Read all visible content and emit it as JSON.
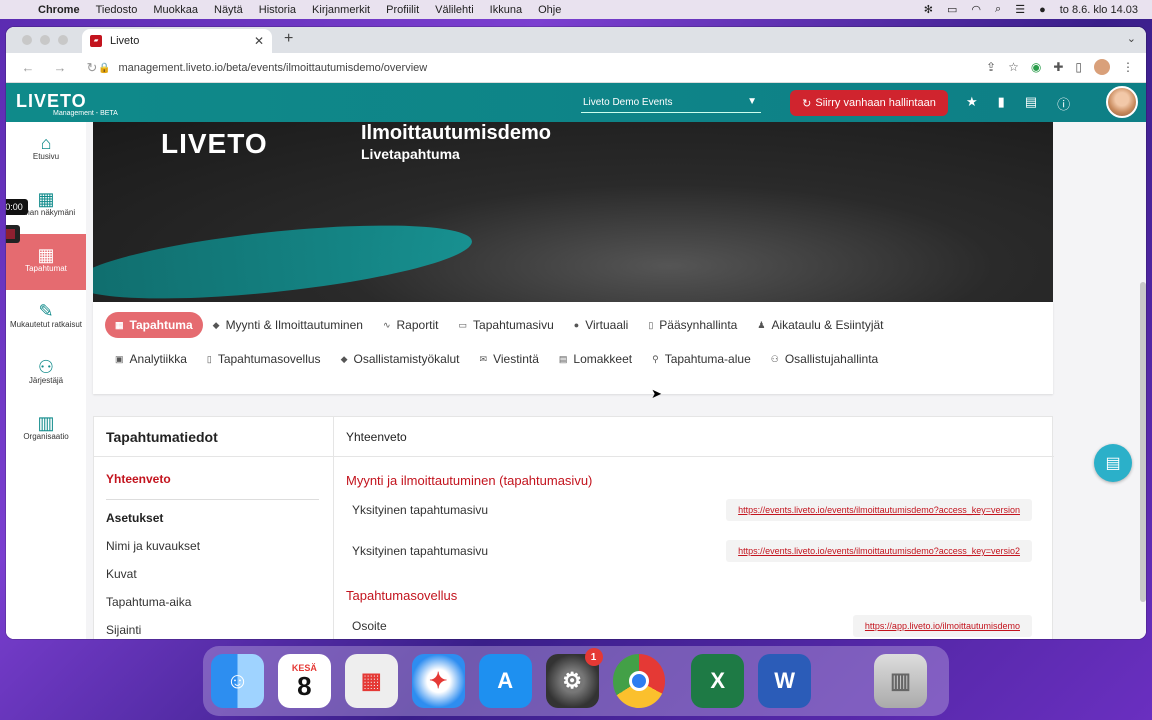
{
  "menubar": {
    "app": "Chrome",
    "items": [
      "Tiedosto",
      "Muokkaa",
      "Näytä",
      "Historia",
      "Kirjanmerkit",
      "Profiilit",
      "Välilehti",
      "Ikkuna",
      "Ohje"
    ],
    "clock": "to 8.6. klo 14.03"
  },
  "browser": {
    "tab_title": "Liveto",
    "url": "management.liveto.io/beta/events/ilmoittautumisdemo/overview"
  },
  "app": {
    "logo": "LIVETO",
    "logo_sub": "Management - BETA",
    "event_select": "Liveto Demo Events",
    "old_mgmt_button": "Siirry vanhaan hallintaan"
  },
  "sidebar": {
    "items": [
      {
        "label": "Etusivu",
        "icon": "home-icon"
      },
      {
        "label": "Oman näkymäni",
        "icon": "layout-icon"
      },
      {
        "label": "Tapahtumat",
        "icon": "calendar-icon"
      },
      {
        "label": "Mukautetut ratkaisut",
        "icon": "edit-icon"
      },
      {
        "label": "Järjestäjä",
        "icon": "users-icon"
      },
      {
        "label": "Organisaatio",
        "icon": "building-icon"
      }
    ],
    "recording_time": "0:00"
  },
  "hero": {
    "brand": "LIVETO",
    "event_title": "Ilmoittautumisdemo",
    "event_subtitle": "Livetapahtuma"
  },
  "event_nav": {
    "row1": [
      "Tapahtuma",
      "Myynti & Ilmoittautuminen",
      "Raportit",
      "Tapahtumasivu",
      "Virtuaali",
      "Pääsynhallinta",
      "Aikataulu & Esiintyjät"
    ],
    "row2": [
      "Analytiikka",
      "Tapahtumasovellus",
      "Osallistamistyökalut",
      "Viestintä",
      "Lomakkeet",
      "Tapahtuma-alue",
      "Osallistujahallinta"
    ]
  },
  "left_panel": {
    "title": "Tapahtumatiedot",
    "active": "Yhteenveto",
    "section": "Asetukset",
    "items": [
      "Nimi ja kuvaukset",
      "Kuvat",
      "Tapahtuma-aika",
      "Sijainti"
    ]
  },
  "summary": {
    "title": "Yhteenveto",
    "sales_title": "Myynti ja ilmoittautuminen (tapahtumasivu)",
    "rows": [
      {
        "label": "Yksityinen tapahtumasivu",
        "link": "https://events.liveto.io/events/ilmoittautumisdemo?access_key=version"
      },
      {
        "label": "Yksityinen tapahtumasivu",
        "link": "https://events.liveto.io/events/ilmoittautumisdemo?access_key=versio2"
      }
    ],
    "app_title": "Tapahtumasovellus",
    "app_row": {
      "label": "Osoite",
      "link": "https://app.liveto.io/ilmoittautumisdemo"
    }
  },
  "dock": {
    "calendar_month": "KESÄ",
    "calendar_day": "8",
    "settings_badge": "1"
  }
}
